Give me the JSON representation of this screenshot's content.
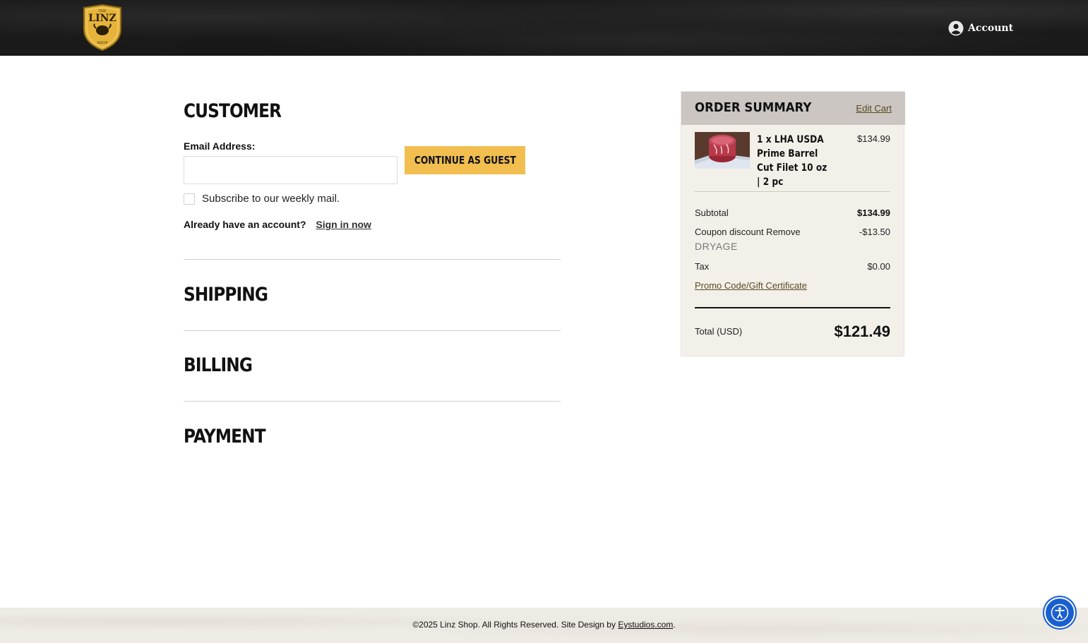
{
  "header": {
    "logo_text": "LINZ",
    "logo_top_text": "THE",
    "logo_bottom_text": "SHOP",
    "account_label": "Account"
  },
  "checkout": {
    "customer_title": "CUSTOMER",
    "email_label": "Email Address:",
    "email_value": "",
    "guest_button": "CONTINUE AS GUEST",
    "subscribe_label": "Subscribe to our weekly mail.",
    "subscribe_checked": false,
    "already_account": "Already have an account?",
    "sign_in": "Sign in now",
    "shipping_title": "SHIPPING",
    "billing_title": "BILLING",
    "payment_title": "PAYMENT"
  },
  "summary": {
    "title": "ORDER SUMMARY",
    "edit_cart": "Edit Cart",
    "item": {
      "name": "1 x LHA USDA Prime Barrel Cut Filet 10 oz | 2 pc",
      "price": "$134.99"
    },
    "subtotal_label": "Subtotal",
    "subtotal_value": "$134.99",
    "coupon_label": "Coupon discount Remove",
    "coupon_value": "-$13.50",
    "coupon_code": "DRYAGE",
    "tax_label": "Tax",
    "tax_value": "$0.00",
    "promo_link": "Promo Code/Gift Certificate",
    "total_label": "Total (USD)",
    "total_value": "$121.49"
  },
  "footer": {
    "text": "©2025 Linz Shop. All Rights Reserved. Site Design by ",
    "link": "Eystudios.com",
    "suffix": "."
  },
  "colors": {
    "accent": "#f1be4f",
    "header_bg": "#1a1a1a",
    "summary_bg": "#f3f0ea",
    "summary_header_bg": "#cbc6c1",
    "a11y_blue": "#1a5fd0"
  },
  "icons": {
    "account": "user-circle-icon",
    "accessibility": "accessibility-icon"
  }
}
